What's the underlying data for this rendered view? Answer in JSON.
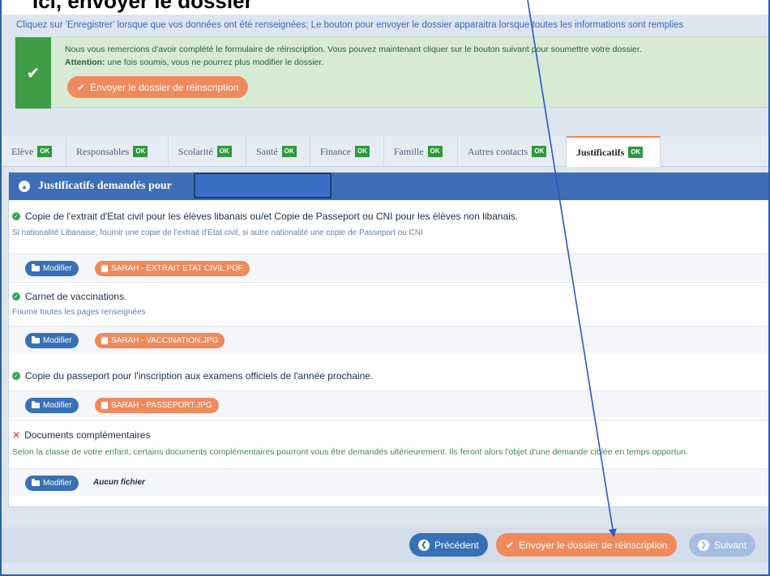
{
  "annotation": {
    "partial_text": "Ici, envoyer le dossier"
  },
  "intro": {
    "text": "Cliquez sur 'Enregistrer' lorsque que vos données ont été renseignées; Le bouton pour envoyer le dossier apparaitra lorsque toutes les informations sont remplies"
  },
  "alert": {
    "line1": "Nous vous remercions d'avoir complété le formulaire de réinscription. Vous pouvez maintenant cliquer sur le bouton suivant pour soumettre votre dossier.",
    "line2_bold": "Attention:",
    "line2_rest": " une fois soumis, vous ne pourrez plus modifier le dossier.",
    "button": "Envoyer le dossier de réinscription",
    "icon": "check-icon"
  },
  "tabs": [
    {
      "label": "Elève",
      "badge": "OK"
    },
    {
      "label": "Responsables",
      "badge": "OK"
    },
    {
      "label": "Scolarité",
      "badge": "OK"
    },
    {
      "label": "Santé",
      "badge": "OK"
    },
    {
      "label": "Finance",
      "badge": "OK"
    },
    {
      "label": "Famille",
      "badge": "OK"
    },
    {
      "label": "Autres contacts",
      "badge": "OK"
    },
    {
      "label": "Justificatifs",
      "badge": "OK",
      "active": true
    }
  ],
  "panel": {
    "title": "Justificatifs demandés pour"
  },
  "documents": [
    {
      "title": "Copie de l'extrait d'Etat civil pour les élèves libanais ou/et Copie de Passeport ou CNI pour les élèves non libanais.",
      "description": "Si nationalité Libanaise, fournir une copie de l'extrait d'Etat civil, si autre nationalité une copie de Passeport ou CNI",
      "status": "ok",
      "modify": "Modifier",
      "file": "SARAH - EXTRAIT ETAT CIVIL.PDF"
    },
    {
      "title": "Carnet de vaccinations.",
      "description": "Fournir toutes les pages renseignées",
      "status": "ok",
      "modify": "Modifier",
      "file": "SARAH - VACCINATION.JPG"
    },
    {
      "title": "Copie du passeport pour l'inscription aux examens officiels de l'année prochaine.",
      "description": "",
      "status": "ok",
      "modify": "Modifier",
      "file": "SARAH - PASSEPORT.JPG"
    },
    {
      "title": "Documents complémentaires",
      "description": "Selon la classe de votre enfant, certains documents complémentaires pourront vous être demandés ultérieurement. Ils feront alors l'objet d'une demande ciblée en temps opportun.",
      "status": "missing",
      "modify": "Modifier",
      "file": "Aucun fichier"
    }
  ],
  "footer": {
    "prev": "Précédent",
    "send": "Envoyer le dossier de réinscription",
    "next": "Suivant"
  },
  "colors": {
    "primary": "#3870b6",
    "accent": "#ef8a5d",
    "success": "#3f9d48",
    "danger": "#d9312b",
    "annotation_arrow": "#2a56c6"
  }
}
